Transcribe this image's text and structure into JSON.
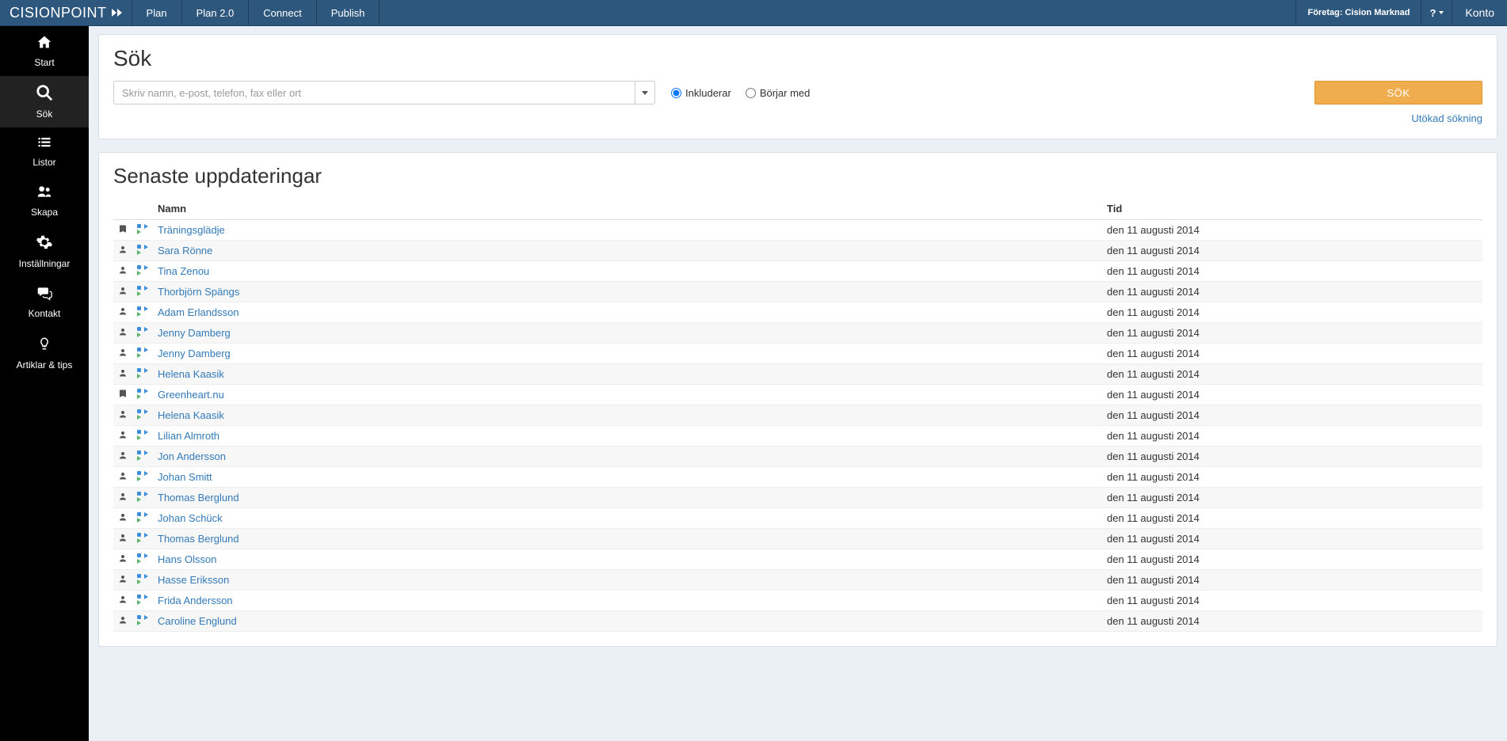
{
  "brand": {
    "name_bold": "CISION",
    "name_light": "POINT"
  },
  "topnav": [
    {
      "label": "Plan"
    },
    {
      "label": "Plan 2.0"
    },
    {
      "label": "Connect"
    },
    {
      "label": "Publish"
    }
  ],
  "company_label": "Företag: Cision Marknad",
  "help_label": "?",
  "account_label": "Konto",
  "sidebar": [
    {
      "id": "start",
      "label": "Start",
      "icon": "🏠"
    },
    {
      "id": "sok",
      "label": "Sök",
      "icon": "search"
    },
    {
      "id": "listor",
      "label": "Listor",
      "icon": "list"
    },
    {
      "id": "skapa",
      "label": "Skapa",
      "icon": "👥"
    },
    {
      "id": "installningar",
      "label": "Inställningar",
      "icon": "⚙"
    },
    {
      "id": "kontakt",
      "label": "Kontakt",
      "icon": "💬"
    },
    {
      "id": "artiklar",
      "label": "Artiklar & tips",
      "icon": "💡"
    }
  ],
  "search": {
    "heading": "Sök",
    "placeholder": "Skriv namn, e-post, telefon, fax eller ort",
    "radio_include": "Inkluderar",
    "radio_starts": "Börjar med",
    "radio_selected": "include",
    "button": "SÖK",
    "advanced": "Utökad sökning"
  },
  "updates": {
    "heading": "Senaste uppdateringar",
    "col_name": "Namn",
    "col_time": "Tid",
    "rows": [
      {
        "type": "book",
        "name": "Träningsglädje",
        "time": "den 11 augusti 2014"
      },
      {
        "type": "person",
        "name": "Sara Rönne",
        "time": "den 11 augusti 2014"
      },
      {
        "type": "person",
        "name": "Tina Zenou",
        "time": "den 11 augusti 2014"
      },
      {
        "type": "person",
        "name": "Thorbjörn Spängs",
        "time": "den 11 augusti 2014"
      },
      {
        "type": "person",
        "name": "Adam Erlandsson",
        "time": "den 11 augusti 2014"
      },
      {
        "type": "person",
        "name": "Jenny Damberg",
        "time": "den 11 augusti 2014"
      },
      {
        "type": "person",
        "name": "Jenny Damberg",
        "time": "den 11 augusti 2014"
      },
      {
        "type": "person",
        "name": "Helena Kaasik",
        "time": "den 11 augusti 2014"
      },
      {
        "type": "book",
        "name": "Greenheart.nu",
        "time": "den 11 augusti 2014"
      },
      {
        "type": "person",
        "name": "Helena Kaasik",
        "time": "den 11 augusti 2014"
      },
      {
        "type": "person",
        "name": "Lilian Almroth",
        "time": "den 11 augusti 2014"
      },
      {
        "type": "person",
        "name": "Jon Andersson",
        "time": "den 11 augusti 2014"
      },
      {
        "type": "person",
        "name": "Johan Smitt",
        "time": "den 11 augusti 2014"
      },
      {
        "type": "person",
        "name": "Thomas Berglund",
        "time": "den 11 augusti 2014"
      },
      {
        "type": "person",
        "name": "Johan Schück",
        "time": "den 11 augusti 2014"
      },
      {
        "type": "person",
        "name": "Thomas Berglund",
        "time": "den 11 augusti 2014"
      },
      {
        "type": "person",
        "name": "Hans Olsson",
        "time": "den 11 augusti 2014"
      },
      {
        "type": "person",
        "name": "Hasse Eriksson",
        "time": "den 11 augusti 2014"
      },
      {
        "type": "person",
        "name": "Frida Andersson",
        "time": "den 11 augusti 2014"
      },
      {
        "type": "person",
        "name": "Caroline Englund",
        "time": "den 11 augusti 2014"
      }
    ]
  }
}
